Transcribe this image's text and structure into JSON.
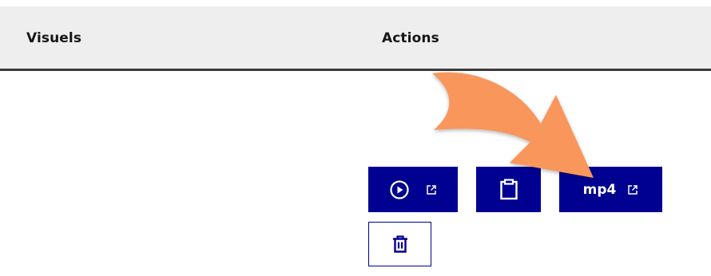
{
  "table": {
    "headers": {
      "visuels": "Visuels",
      "actions": "Actions"
    }
  },
  "actions": {
    "play_icon": "play-circle-icon",
    "external_icon": "external-link-icon",
    "copy_icon": "clipboard-icon",
    "mp4_label": "mp4",
    "delete_icon": "trash-icon"
  },
  "colors": {
    "primary": "#000091",
    "header_bg": "#eeeeee",
    "arrow": "#f8965c"
  }
}
